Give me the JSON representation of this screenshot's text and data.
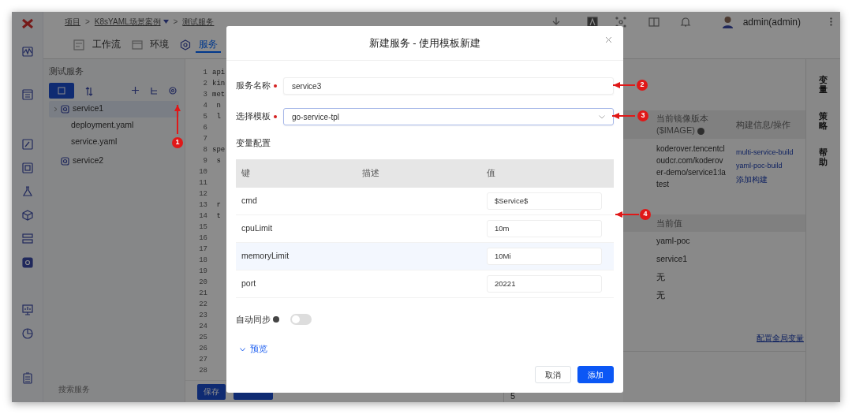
{
  "breadcrumb": {
    "separator": ">",
    "items": [
      {
        "label": "项目",
        "dropdown": false
      },
      {
        "label": "K8sYAML场景案例",
        "dropdown": true
      },
      {
        "label": "测试服务",
        "dropdown": false
      }
    ]
  },
  "user": {
    "name": "admin(admin)"
  },
  "tabs": [
    {
      "label": "工作流",
      "selected": false
    },
    {
      "label": "环境",
      "selected": false
    },
    {
      "label": "服务",
      "selected": true
    }
  ],
  "service_panel": {
    "title": "测试服务",
    "tree": [
      {
        "label": "service1",
        "selected": true,
        "expanded": true,
        "children": [
          {
            "label": "deployment.yaml",
            "selected": false
          },
          {
            "label": "service.yaml",
            "selected": false
          }
        ]
      },
      {
        "label": "service2",
        "selected": false,
        "expanded": false
      }
    ],
    "search": {
      "placeholder": "搜索服务"
    }
  },
  "editor": {
    "lines": [
      {
        "number": "1",
        "text": "api"
      },
      {
        "number": "2",
        "text": "kin"
      },
      {
        "number": "3",
        "text": "met"
      },
      {
        "number": "4",
        "text": " n"
      },
      {
        "number": "5",
        "text": " l"
      },
      {
        "number": "6"
      },
      {
        "number": "7"
      },
      {
        "number": "8",
        "text": "spe"
      },
      {
        "number": "9",
        "text": " s"
      },
      {
        "number": "10"
      },
      {
        "number": "11"
      },
      {
        "number": "12"
      },
      {
        "number": "13",
        "text": " r"
      },
      {
        "number": "14",
        "text": " t"
      },
      {
        "number": "15"
      },
      {
        "number": "16"
      },
      {
        "number": "17"
      },
      {
        "number": "18"
      },
      {
        "number": "19"
      },
      {
        "number": "20"
      },
      {
        "number": "21"
      },
      {
        "number": "22"
      },
      {
        "number": "23"
      },
      {
        "number": "24"
      },
      {
        "number": "25"
      },
      {
        "number": "26"
      },
      {
        "number": "27"
      },
      {
        "number": "28"
      }
    ],
    "save_button": "保存",
    "footer_value": "5"
  },
  "images_table": {
    "columns": [
      "当前镜像版本($IMAGE)",
      "构建信息/操作"
    ],
    "rows": [
      {
        "image": "koderover.tencentcloudcr.com/koderover-demo/service1:latest",
        "builds": [
          "multi-service-build",
          "yaml-poc-build"
        ],
        "add_build": "添加构建"
      }
    ]
  },
  "variables_table": {
    "columns": [
      "当前值"
    ],
    "rows": [
      "yaml-poc",
      "service1",
      "无",
      "无"
    ],
    "link": "配置全局变量"
  },
  "side_tabs": [
    "变量",
    "策略",
    "帮助"
  ],
  "modal": {
    "title": "新建服务 - 使用模板新建",
    "fields": [
      {
        "label": "服务名称",
        "required": true,
        "kind": "text",
        "value": "service3"
      },
      {
        "label": "选择模板",
        "required": true,
        "kind": "select",
        "value": "go-service-tpl"
      }
    ],
    "variables": {
      "title": "变量配置",
      "columns": [
        "键",
        "描述",
        "值"
      ],
      "rows": [
        {
          "key": "cmd",
          "value": "$Service$",
          "highlighted": false
        },
        {
          "key": "cpuLimit",
          "value": "10m",
          "highlighted": false
        },
        {
          "key": "memoryLimit",
          "value": "10Mi",
          "highlighted": true
        },
        {
          "key": "port",
          "value": "20221",
          "highlighted": false
        }
      ]
    },
    "auto_sync": {
      "label": "自动同步",
      "on": false
    },
    "preview": {
      "label": "预览",
      "expanded": false
    },
    "buttons": [
      {
        "label": "取消",
        "kind": "secondary"
      },
      {
        "label": "添加",
        "kind": "primary"
      }
    ]
  },
  "annotations": [
    {
      "label": "1"
    },
    {
      "label": "2"
    },
    {
      "label": "3"
    },
    {
      "label": "4"
    }
  ]
}
